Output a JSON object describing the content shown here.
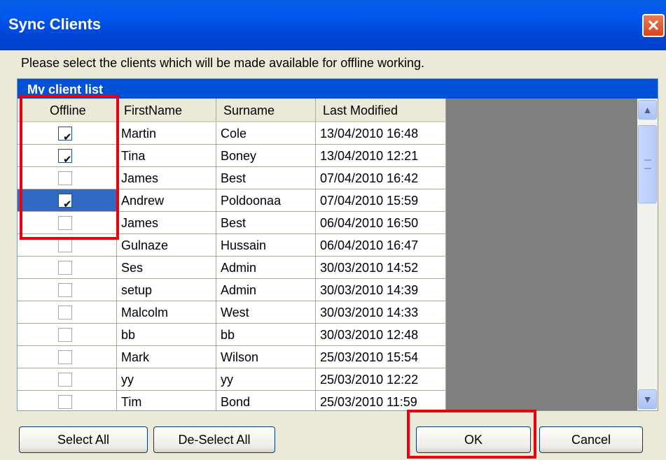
{
  "window": {
    "title": "Sync Clients",
    "close_glyph": "✕"
  },
  "instruction": "Please select the clients which will be made available for offline working.",
  "list": {
    "header": "My client list",
    "columns": [
      "Offline",
      "FirstName",
      "Surname",
      "Last Modified"
    ],
    "rows": [
      {
        "offline": true,
        "first": "Martin",
        "surname": "Cole",
        "modified": "13/04/2010 16:48"
      },
      {
        "offline": true,
        "first": "Tina",
        "surname": "Boney",
        "modified": "13/04/2010 12:21"
      },
      {
        "offline": false,
        "first": "James",
        "surname": "Best",
        "modified": "07/04/2010 16:42"
      },
      {
        "offline": true,
        "first": "Andrew",
        "surname": "Poldoonaa",
        "modified": "07/04/2010 15:59",
        "selected": true
      },
      {
        "offline": false,
        "first": "James",
        "surname": "Best",
        "modified": "06/04/2010 16:50"
      },
      {
        "offline": false,
        "first": "Gulnaze",
        "surname": "Hussain",
        "modified": "06/04/2010 16:47"
      },
      {
        "offline": false,
        "first": "Ses",
        "surname": "Admin",
        "modified": "30/03/2010 14:52"
      },
      {
        "offline": false,
        "first": "setup",
        "surname": "Admin",
        "modified": "30/03/2010 14:39"
      },
      {
        "offline": false,
        "first": "Malcolm",
        "surname": "West",
        "modified": "30/03/2010 14:33"
      },
      {
        "offline": false,
        "first": "bb",
        "surname": "bb",
        "modified": "30/03/2010 12:48"
      },
      {
        "offline": false,
        "first": "Mark",
        "surname": "Wilson",
        "modified": "25/03/2010 15:54"
      },
      {
        "offline": false,
        "first": "yy",
        "surname": "yy",
        "modified": "25/03/2010 12:22"
      },
      {
        "offline": false,
        "first": "Tim",
        "surname": "Bond",
        "modified": "25/03/2010 11:59"
      }
    ],
    "check_glyph": "✔",
    "scroll_up_glyph": "▲",
    "scroll_down_glyph": "▼"
  },
  "buttons": {
    "select_all": "Select All",
    "deselect_all": "De-Select All",
    "ok": "OK",
    "cancel": "Cancel"
  },
  "colors": {
    "title_blue": "#0050D8",
    "selected_row": "#316AC5",
    "highlight": "#E8000D",
    "grid_empty": "#808080"
  }
}
